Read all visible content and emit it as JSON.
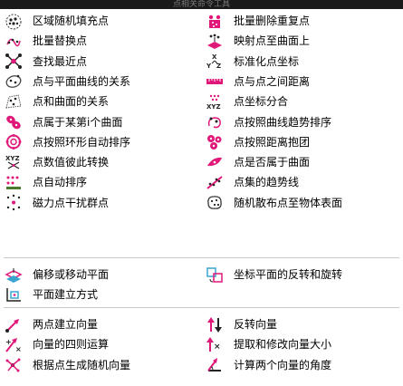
{
  "window": {
    "title": "点相关命令工具"
  },
  "sections": [
    {
      "items": [
        {
          "label": "区域随机填充点",
          "icon": "region-random-fill-icon"
        },
        {
          "label": "批量删除重复点",
          "icon": "delete-duplicate-points-icon"
        },
        {
          "label": "批量替换点",
          "icon": "batch-replace-points-icon"
        },
        {
          "label": "映射点至曲面上",
          "icon": "map-points-to-surface-icon"
        },
        {
          "label": "查找最近点",
          "icon": "find-nearest-point-icon"
        },
        {
          "label": "标准化点坐标",
          "icon": "normalize-coordinates-icon"
        },
        {
          "label": "点与平面曲线的关系",
          "icon": "point-plane-curve-relation-icon"
        },
        {
          "label": "点与点之间距离",
          "icon": "point-distance-icon"
        },
        {
          "label": "点和曲面的关系",
          "icon": "point-surface-relation-icon"
        },
        {
          "label": "点坐标分合",
          "icon": "coordinate-split-merge-icon"
        },
        {
          "label": "点属于某第i个曲面",
          "icon": "point-in-ith-surface-icon"
        },
        {
          "label": "点按照曲线趋势排序",
          "icon": "sort-by-curve-trend-icon"
        },
        {
          "label": "点按照环形自动排序",
          "icon": "circular-sort-icon"
        },
        {
          "label": "点按照距离抱团",
          "icon": "cluster-by-distance-icon"
        },
        {
          "label": "点数值彼此转换",
          "icon": "value-convert-icon"
        },
        {
          "label": "点是否属于曲面",
          "icon": "point-on-surface-icon"
        },
        {
          "label": "点自动排序",
          "icon": "auto-sort-icon"
        },
        {
          "label": "点集的趋势线",
          "icon": "trend-line-icon"
        },
        {
          "label": "磁力点干扰群点",
          "icon": "magnetic-point-icon"
        },
        {
          "label": "随机散布点至物体表面",
          "icon": "random-scatter-surface-icon"
        }
      ]
    },
    {
      "items": [
        {
          "label": "偏移或移动平面",
          "icon": "offset-plane-icon"
        },
        {
          "label": "坐标平面的反转和旋转",
          "icon": "flip-rotate-plane-icon"
        },
        {
          "label": "平面建立方式",
          "icon": "plane-construct-icon"
        }
      ]
    },
    {
      "items": [
        {
          "label": "两点建立向量",
          "icon": "two-point-vector-icon"
        },
        {
          "label": "反转向量",
          "icon": "reverse-vector-icon"
        },
        {
          "label": "向量的四则运算",
          "icon": "vector-arithmetic-icon"
        },
        {
          "label": "提取和修改向量大小",
          "icon": "vector-magnitude-icon"
        },
        {
          "label": "根据点生成随机向量",
          "icon": "random-vector-icon"
        },
        {
          "label": "计算两个向量的角度",
          "icon": "vector-angle-icon"
        }
      ]
    }
  ],
  "colors": {
    "accent_magenta": "#e0187a",
    "icon_dark": "#222222",
    "separator": "#c8c8c8"
  }
}
